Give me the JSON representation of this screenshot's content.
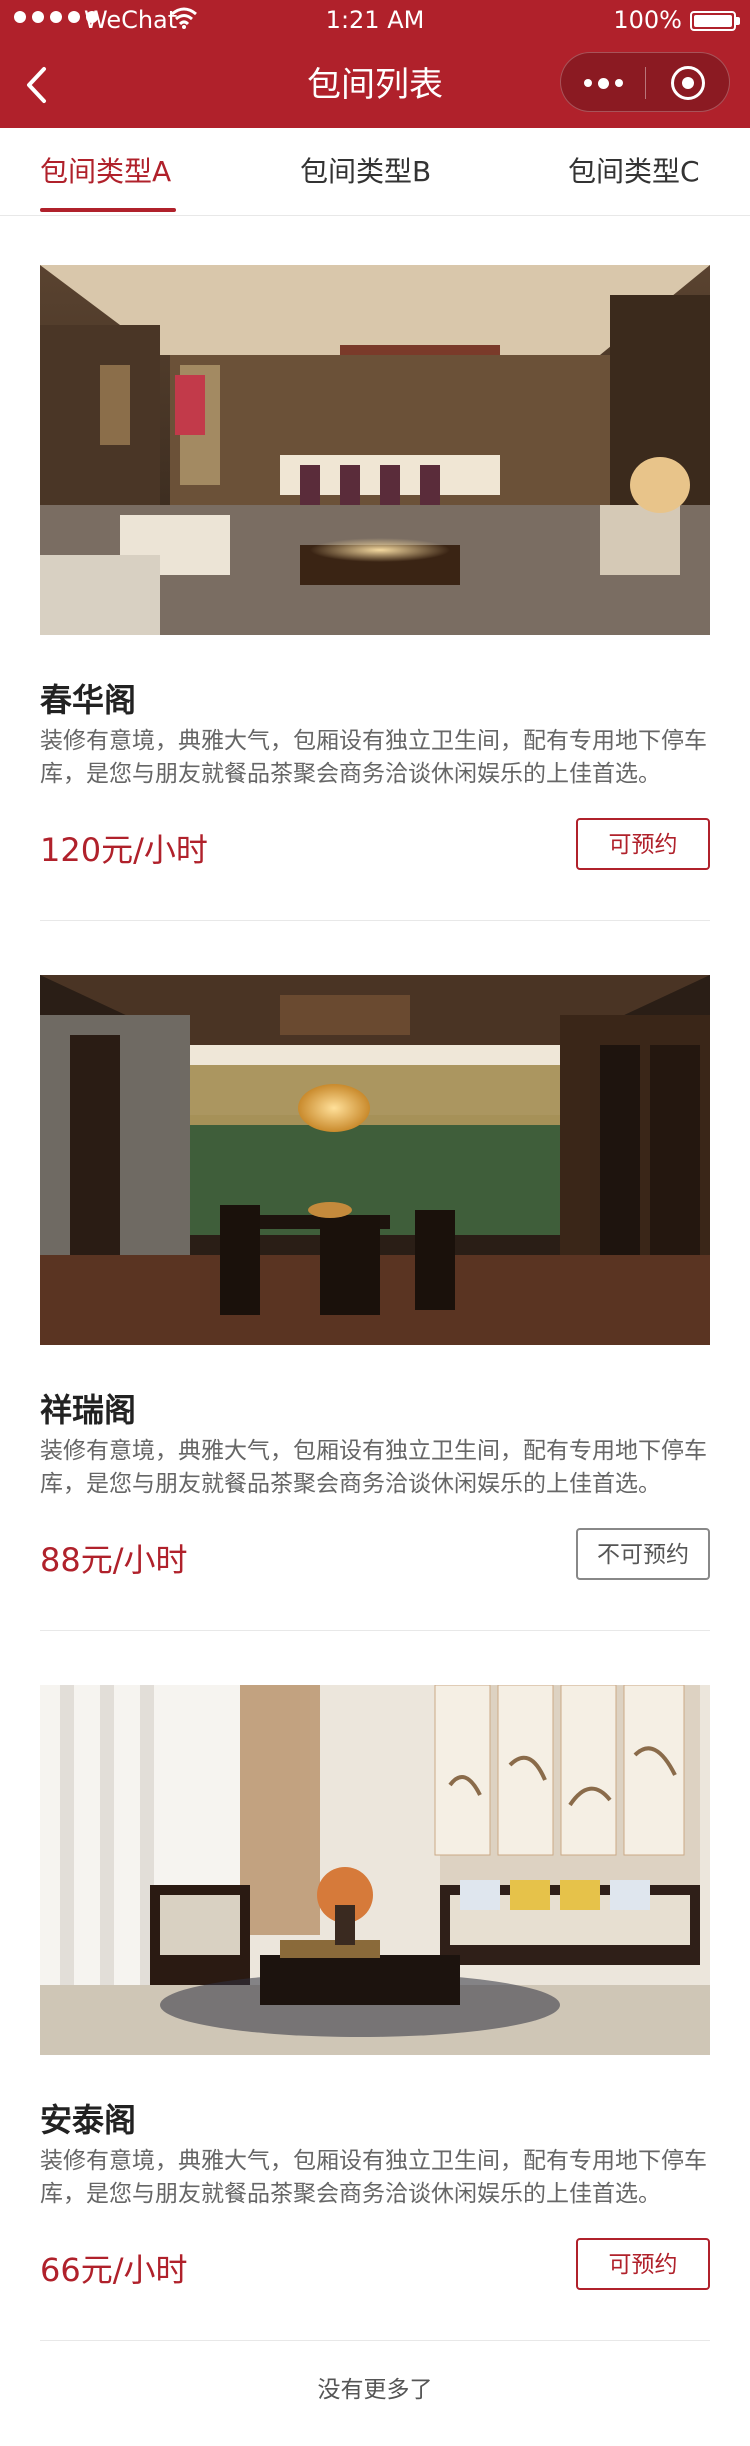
{
  "status_bar": {
    "carrier": "WeChat",
    "time": "1:21 AM",
    "battery": "100%"
  },
  "nav": {
    "title": "包间列表"
  },
  "tabs": [
    {
      "label": "包间类型A",
      "active": true
    },
    {
      "label": "包间类型B",
      "active": false
    },
    {
      "label": "包间类型C",
      "active": false
    }
  ],
  "rooms": [
    {
      "name": "春华阁",
      "description": "装修有意境，典雅大气，包厢设有独立卫生间，配有专用地下停车库，是您与朋友就餐品茶聚会商务洽谈休闲娱乐的上佳首选。",
      "price": "120元/小时",
      "action": "可预约",
      "available": true
    },
    {
      "name": "祥瑞阁",
      "description": "装修有意境，典雅大气，包厢设有独立卫生间，配有专用地下停车库，是您与朋友就餐品茶聚会商务洽谈休闲娱乐的上佳首选。",
      "price": "88元/小时",
      "action": "不可预约",
      "available": false
    },
    {
      "name": "安泰阁",
      "description": "装修有意境，典雅大气，包厢设有独立卫生间，配有专用地下停车库，是您与朋友就餐品茶聚会商务洽谈休闲娱乐的上佳首选。",
      "price": "66元/小时",
      "action": "可预约",
      "available": true
    }
  ],
  "footer": {
    "no_more": "没有更多了"
  },
  "colors": {
    "brand": "#b0212b",
    "text": "#333333",
    "muted": "#666666"
  }
}
